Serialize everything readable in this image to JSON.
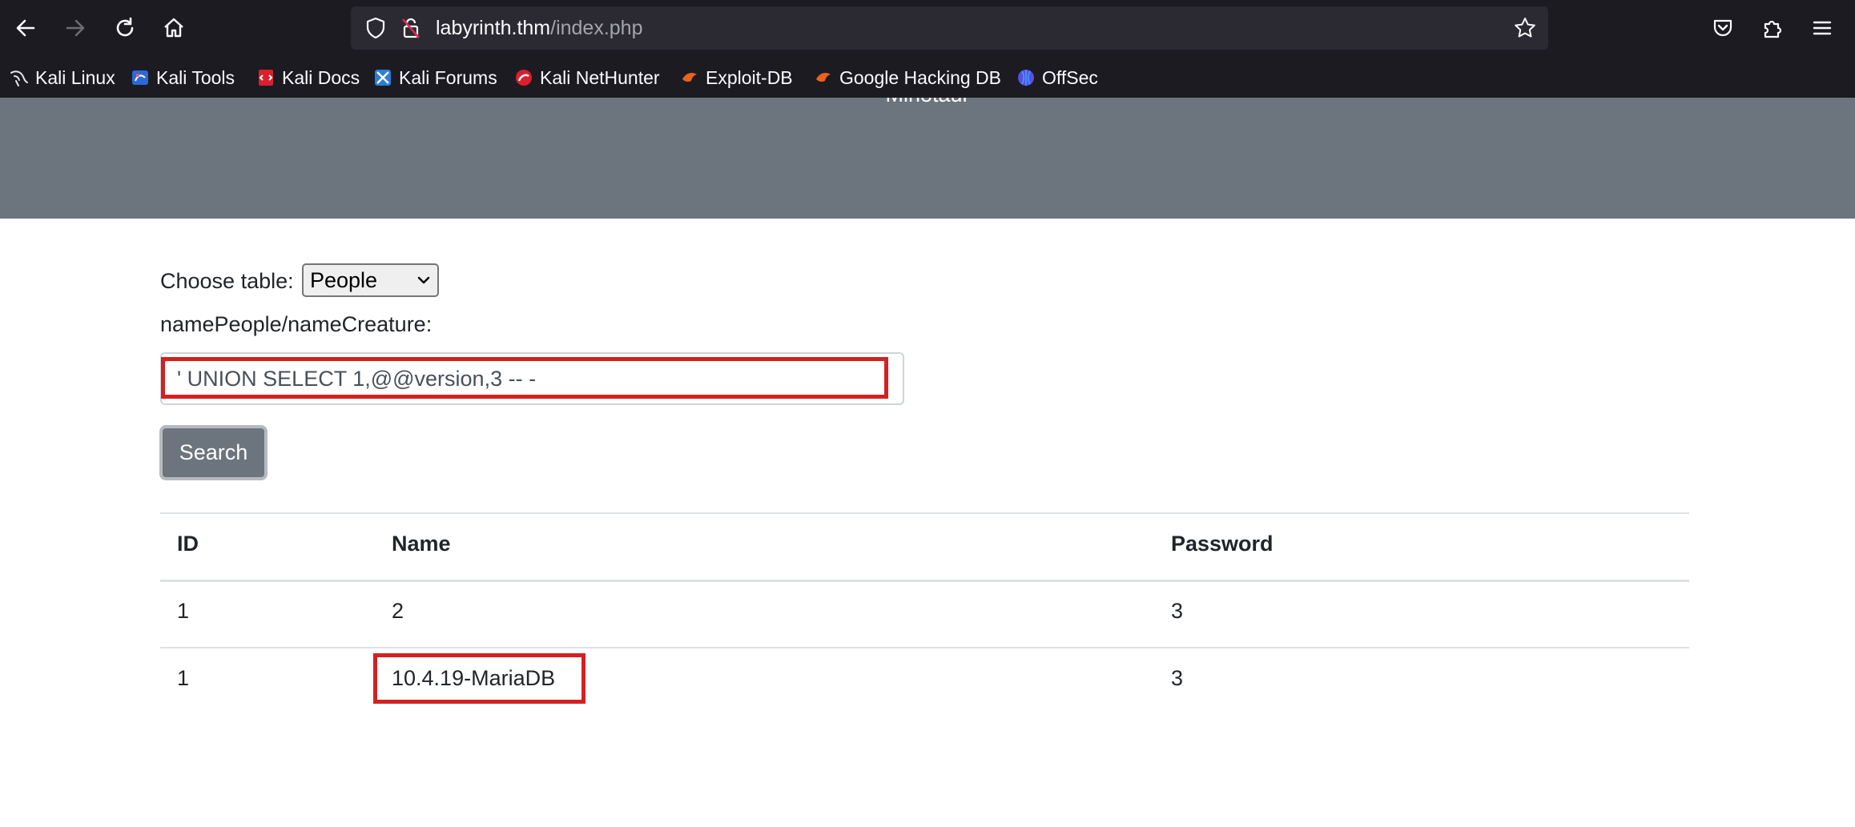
{
  "browser": {
    "url_host": "labyrinth.thm",
    "url_path": "/index.php",
    "bookmarks": [
      {
        "label": "Kali Linux",
        "icon": "kali-dragon-icon"
      },
      {
        "label": "Kali Tools",
        "icon": "kali-tools-icon"
      },
      {
        "label": "Kali Docs",
        "icon": "kali-docs-icon"
      },
      {
        "label": "Kali Forums",
        "icon": "kali-forums-icon"
      },
      {
        "label": "Kali NetHunter",
        "icon": "kali-nethunter-icon"
      },
      {
        "label": "Exploit-DB",
        "icon": "exploit-db-icon"
      },
      {
        "label": "Google Hacking DB",
        "icon": "exploit-db-icon"
      },
      {
        "label": "OffSec",
        "icon": "offsec-icon"
      }
    ]
  },
  "page": {
    "hero_title": "Minotaur",
    "choose_label": "Choose table:",
    "table_select_value": "People",
    "name_label": "namePeople/nameCreature:",
    "search_value": "' UNION SELECT 1,@@version,3 -- -",
    "search_button": "Search",
    "table": {
      "headers": [
        "ID",
        "Name",
        "Password"
      ],
      "rows": [
        [
          "1",
          "2",
          "3"
        ],
        [
          "1",
          "10.4.19-MariaDB",
          "3"
        ]
      ]
    }
  },
  "colors": {
    "highlight": "#d42020",
    "hero": "#6c757d",
    "chrome": "#1c1b22"
  }
}
